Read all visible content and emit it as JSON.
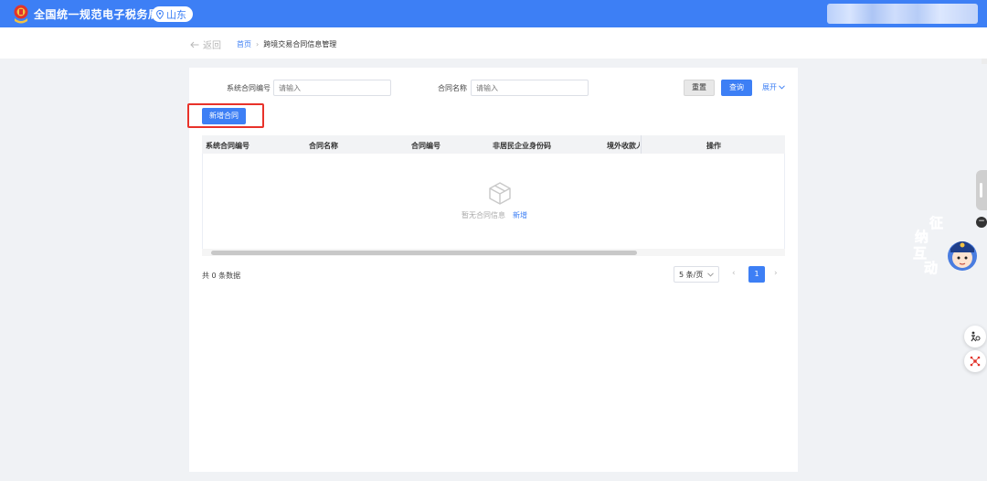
{
  "header": {
    "app_title": "全国统一规范电子税务局",
    "region": "山东",
    "brand_color": "#3d7ff5"
  },
  "breadcrumb": {
    "back_label": "返回",
    "home": "首页",
    "separator": "›",
    "current": "跨境交易合同信息管理"
  },
  "search": {
    "field1_label": "系统合同编号",
    "field1_placeholder": "请输入",
    "field2_label": "合同名称",
    "field2_placeholder": "请输入",
    "reset_label": "重置",
    "query_label": "查询",
    "expand_label": "展开"
  },
  "actions": {
    "add_contract_label": "新增合同",
    "highlight_color": "#e8322a"
  },
  "table": {
    "columns": [
      "系统合同编号",
      "合同名称",
      "合同编号",
      "非居民企业身份码",
      "境外收款人",
      "操作"
    ],
    "empty_text": "暂无合同信息",
    "empty_add_link": "新增"
  },
  "pagination": {
    "total_text": "共 0 条数据",
    "page_size": "5 条/页",
    "current_page": "1",
    "prev_icon": "chevron-left",
    "next_icon": "chevron-right"
  },
  "widgets": {
    "mascot_text": [
      "征",
      "纳",
      "互",
      "动"
    ],
    "collapse_icon": "minus-icon",
    "tool1_icon": "accessibility-icon",
    "tool2_icon": "network-icon"
  }
}
